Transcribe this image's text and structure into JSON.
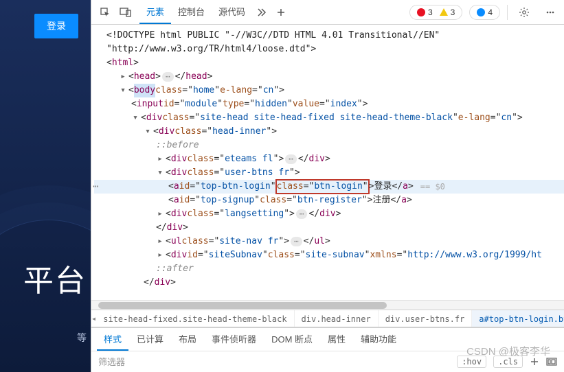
{
  "site": {
    "login_label": "登录",
    "big_text": "平台",
    "small_text": "等"
  },
  "toolbar": {
    "tabs": {
      "elements": "元素",
      "console": "控制台",
      "sources": "源代码"
    },
    "badges": {
      "errors": "3",
      "warnings": "3",
      "info": "4"
    }
  },
  "dom": {
    "doctype_a": "<!DOCTYPE html PUBLIC \"-//W3C//DTD HTML 4.01 Transitional//EN\"",
    "doctype_b": "\"http://www.w3.org/TR/html4/loose.dtd\">",
    "html_open": "html",
    "head_open": "head",
    "head_close": "head",
    "body_tag": "body",
    "body_attr1_n": "class",
    "body_attr1_v": "home",
    "body_attr2_n": "e-lang",
    "body_attr2_v": "cn",
    "input_tag": "input",
    "input_a1n": "id",
    "input_a1v": "module",
    "input_a2n": "type",
    "input_a2v": "hidden",
    "input_a3n": "value",
    "input_a3v": "index",
    "div1_tag": "div",
    "div1_a1n": "class",
    "div1_a1v": "site-head site-head-fixed  site-head-theme-black",
    "div1_a2n": "e-lang",
    "div1_a2v": "cn",
    "div2_tag": "div",
    "div2_a1n": "class",
    "div2_a1v": "head-inner",
    "before": "::before",
    "div3_tag": "div",
    "div3_a1n": "class",
    "div3_a1v": "eteams fl",
    "div3_close": "div",
    "div4_tag": "div",
    "div4_a1n": "class",
    "div4_a1v": "user-btns fr",
    "a1_tag": "a",
    "a1_idn": "id",
    "a1_idv": "top-btn-login",
    "a1_cln": "class",
    "a1_clv": "btn-login",
    "a1_text": "登录",
    "a1_close": "a",
    "a1_hint": "== $0",
    "a2_tag": "a",
    "a2_idn": "id",
    "a2_idv": "top-signup",
    "a2_cln": "class",
    "a2_clv": "btn-register",
    "a2_text": "注册",
    "a2_close": "a",
    "div5_tag": "div",
    "div5_a1n": "class",
    "div5_a1v": "langsetting",
    "div5_close": "div",
    "close_div_a": "div",
    "ul_tag": "ul",
    "ul_a1n": "class",
    "ul_a1v": "site-nav fr",
    "ul_close": "ul",
    "div6_tag": "div",
    "div6_a1n": "id",
    "div6_a1v": "siteSubnav",
    "div6_a2n": "class",
    "div6_a2v": "site-subnav",
    "div6_a3n": "xmlns",
    "div6_a3v": "http://www.w3.org/1999/ht",
    "after": "::after",
    "close_div_b": "div"
  },
  "breadcrumb": {
    "c1": "site-head-fixed.site-head-theme-black",
    "c2": "div.head-inner",
    "c3": "div.user-btns.fr",
    "c4": "a#top-btn-login.btn-logi"
  },
  "styles": {
    "tabs": {
      "styles": "样式",
      "computed": "已计算",
      "layout": "布局",
      "listeners": "事件侦听器",
      "dom_bp": "DOM 断点",
      "props": "属性",
      "a11y": "辅助功能"
    },
    "filter_placeholder": "筛选器",
    "hov": ":hov",
    "cls": ".cls"
  },
  "watermark": "CSDN @极客李华"
}
